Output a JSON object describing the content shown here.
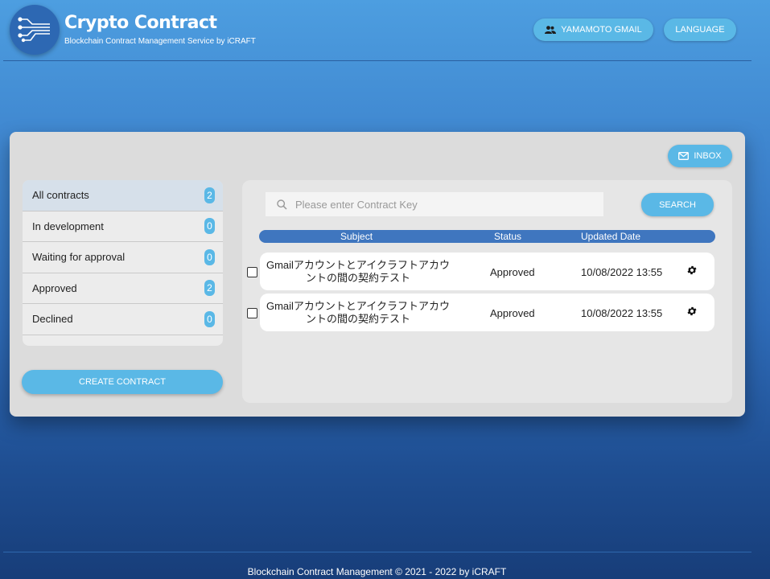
{
  "header": {
    "title": "Crypto Contract",
    "subtitle": "Blockchain Contract Management Service by iCRAFT",
    "user_label": "YAMAMOTO GMAIL",
    "language_label": "LANGUAGE"
  },
  "inbox_label": "INBOX",
  "sidebar": {
    "items": [
      {
        "label": "All contracts",
        "count": "2"
      },
      {
        "label": "In development",
        "count": "0"
      },
      {
        "label": "Waiting for approval",
        "count": "0"
      },
      {
        "label": "Approved",
        "count": "2"
      },
      {
        "label": "Declined",
        "count": "0"
      }
    ],
    "create_label": "CREATE CONTRACT"
  },
  "search": {
    "placeholder": "Please enter Contract Key",
    "button_label": "SEARCH"
  },
  "table": {
    "columns": [
      "Subject",
      "Status",
      "Updated Date"
    ],
    "rows": [
      {
        "subject_line1": "Gmailアカウントとアイクラフトアカウ",
        "subject_line2": "ントの間の契約テスト",
        "status": "Approved",
        "updated": "10/08/2022 13:55"
      },
      {
        "subject_line1": "Gmailアカウントとアイクラフトアカウ",
        "subject_line2": "ントの間の契約テスト",
        "status": "Approved",
        "updated": "10/08/2022 13:55"
      }
    ]
  },
  "footer": {
    "text": "Blockchain Contract Management © 2021 - 2022 by iCRAFT"
  },
  "colors": {
    "accent": "#5ab8e6",
    "table_header": "#3f76bf",
    "background_top": "#4d9ee0",
    "background_bottom": "#173d79"
  },
  "icons": [
    "circuit-logo-icon",
    "users-icon",
    "mail-icon",
    "search-icon",
    "gear-icon"
  ]
}
